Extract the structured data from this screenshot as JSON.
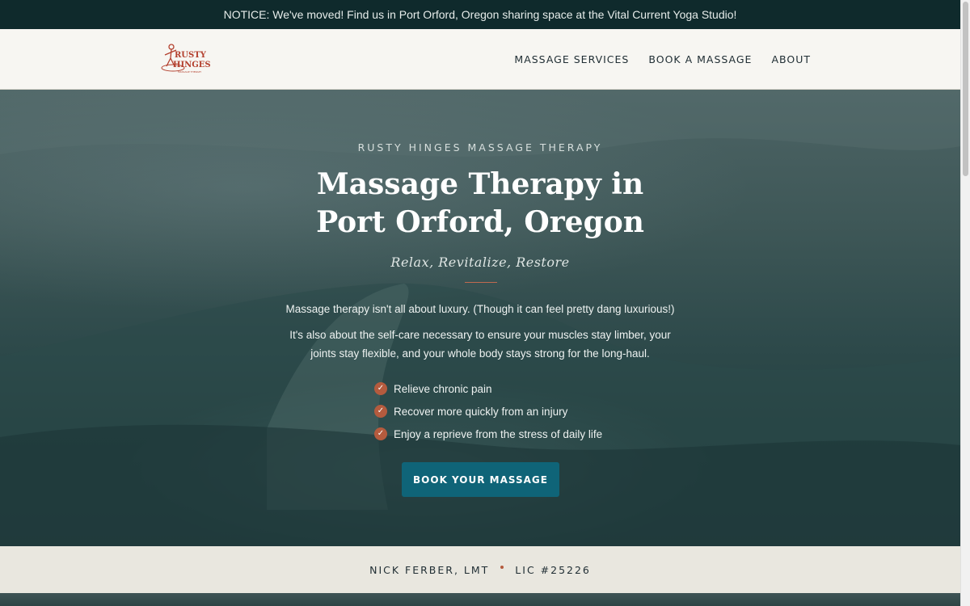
{
  "notice": {
    "text": "NOTICE: We've moved! Find us in Port Orford, Oregon sharing space at the Vital Current Yoga Studio!"
  },
  "header": {
    "logo": {
      "line1": "RUSTY",
      "line2": "HINGES",
      "line3": "MASSAGE THERAPY"
    },
    "nav": [
      {
        "label": "MASSAGE SERVICES"
      },
      {
        "label": "BOOK A MASSAGE"
      },
      {
        "label": "ABOUT"
      }
    ]
  },
  "hero": {
    "eyebrow": "RUSTY HINGES MASSAGE THERAPY",
    "title": "Massage Therapy in Port Orford, Oregon",
    "tagline": "Relax, Revitalize, Restore",
    "intro1": "Massage therapy isn't all about luxury. (Though it can feel pretty dang luxurious!)",
    "intro2": "It's also about the self-care necessary to ensure your muscles stay limber, your joints stay flexible, and your whole body stays strong for the long-haul.",
    "benefits": [
      "Relieve chronic pain",
      "Recover more quickly from an injury",
      "Enjoy a reprieve from the stress of daily life"
    ],
    "cta_label": "BOOK YOUR MASSAGE"
  },
  "license": {
    "name": "NICK FERBER, LMT",
    "number": "LIC #25226"
  },
  "colors": {
    "notice_bg": "#0f2a2c",
    "header_bg": "#f7f6f2",
    "accent": "#b45b3e",
    "button": "#0f6478",
    "license_bg": "#e9e7df"
  },
  "icons": {
    "benefit_check": "check-icon",
    "logo": "rusty-hinges-logo"
  }
}
